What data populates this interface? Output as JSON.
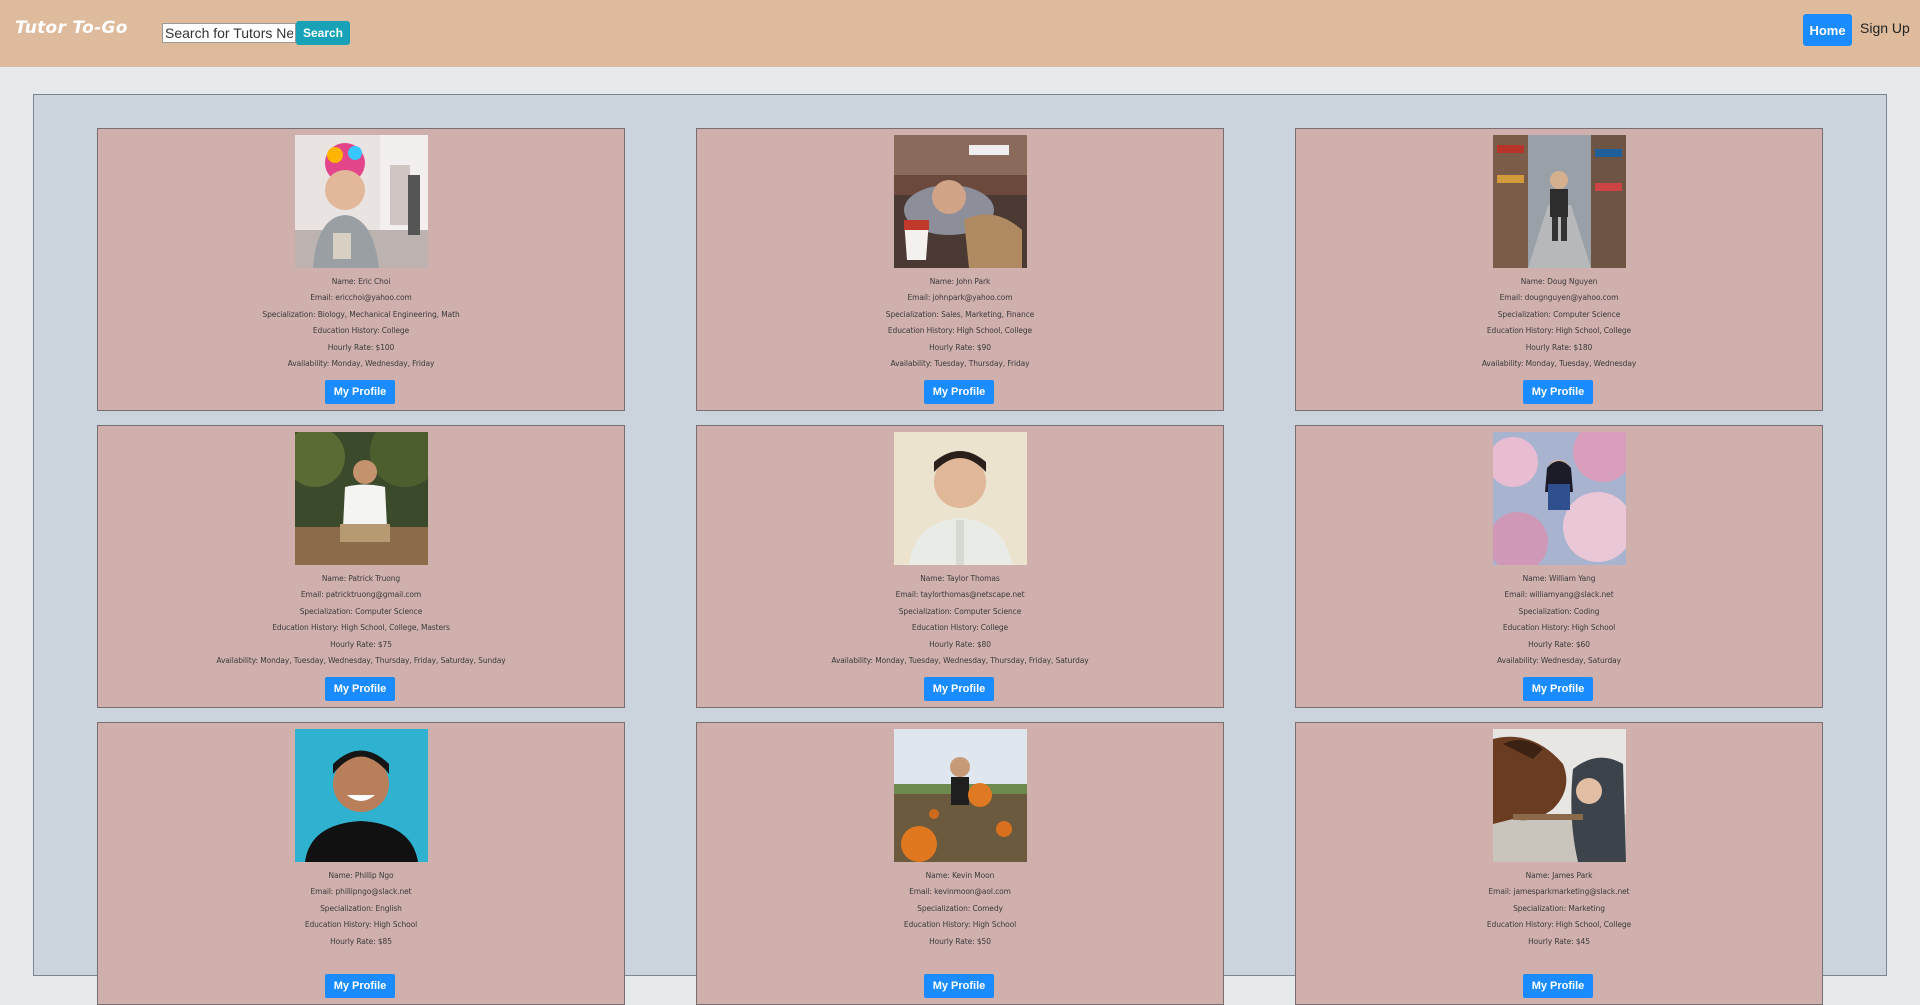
{
  "navbar": {
    "brand": "Tutor To-Go",
    "search_placeholder": "Search for Tutors Near",
    "search_label": "Search",
    "home_label": "Home",
    "signup_label": "Sign Up"
  },
  "tutors": [
    {
      "name": "Name: Eric Choi",
      "email": "Email: ericchoi@yahoo.com",
      "specialization": "Specialization: Biology, Mechanical Engineering, Math",
      "education": "Education History: College",
      "rate": "Hourly Rate: $100",
      "availability": "Availability: Monday, Wednesday, Friday",
      "button": "My Profile"
    },
    {
      "name": "Name: John Park",
      "email": "Email: johnpark@yahoo.com",
      "specialization": "Specialization: Sales, Marketing, Finance",
      "education": "Education History: High School, College",
      "rate": "Hourly Rate: $90",
      "availability": "Availability: Tuesday, Thursday, Friday",
      "button": "My Profile"
    },
    {
      "name": "Name: Doug Nguyen",
      "email": "Email: dougnguyen@yahoo.com",
      "specialization": "Specialization: Computer Science",
      "education": "Education History: High School, College",
      "rate": "Hourly Rate: $180",
      "availability": "Availability: Monday, Tuesday, Wednesday",
      "button": "My Profile"
    },
    {
      "name": "Name: Patrick Truong",
      "email": "Email: patricktruong@gmail.com",
      "specialization": "Specialization: Computer Science",
      "education": "Education History: High School, College, Masters",
      "rate": "Hourly Rate: $75",
      "availability": "Availability: Monday, Tuesday, Wednesday, Thursday, Friday, Saturday, Sunday",
      "button": "My Profile"
    },
    {
      "name": "Name: Taylor Thomas",
      "email": "Email: taylorthomas@netscape.net",
      "specialization": "Specialization: Computer Science",
      "education": "Education History: College",
      "rate": "Hourly Rate: $80",
      "availability": "Availability: Monday, Tuesday, Wednesday, Thursday, Friday, Saturday",
      "button": "My Profile"
    },
    {
      "name": "Name: William Yang",
      "email": "Email: williamyang@slack.net",
      "specialization": "Specialization: Coding",
      "education": "Education History: High School",
      "rate": "Hourly Rate: $60",
      "availability": "Availability: Wednesday, Saturday",
      "button": "My Profile"
    },
    {
      "name": "Name: Phillip Ngo",
      "email": "Email: phillipngo@slack.net",
      "specialization": "Specialization: English",
      "education": "Education History: High School",
      "rate": "Hourly Rate: $85",
      "availability": "",
      "button": "My Profile"
    },
    {
      "name": "Name: Kevin Moon",
      "email": "Email: kevinmoon@aol.com",
      "specialization": "Specialization: Comedy",
      "education": "Education History: High School",
      "rate": "Hourly Rate: $50",
      "availability": "",
      "button": "My Profile"
    },
    {
      "name": "Name: James Park",
      "email": "Email: jamesparkmarketing@slack.net",
      "specialization": "Specialization: Marketing",
      "education": "Education History: High School, College",
      "rate": "Hourly Rate: $45",
      "availability": "",
      "button": "My Profile"
    }
  ],
  "colors": {
    "navbar_bg": "#dfbb9e",
    "card_bg": "#d0b0ad",
    "container_bg": "#cbd3dd",
    "primary_button": "#1a8cff",
    "search_button": "#17a2b8"
  }
}
